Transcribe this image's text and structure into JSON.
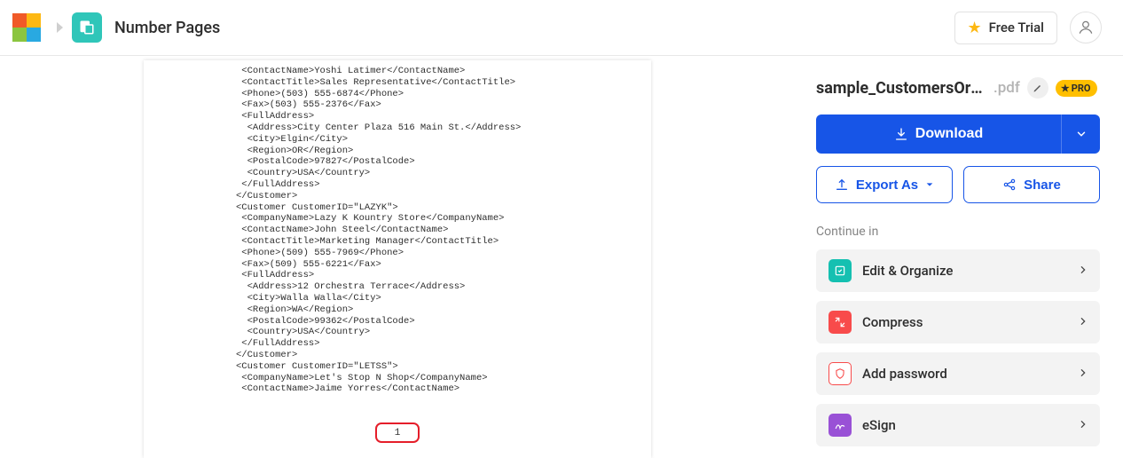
{
  "header": {
    "app_title": "Number Pages",
    "free_trial_label": "Free Trial"
  },
  "preview": {
    "page_number": "1",
    "xml": " <ContactName>Yoshi Latimer</ContactName>\n <ContactTitle>Sales Representative</ContactTitle>\n <Phone>(503) 555-6874</Phone>\n <Fax>(503) 555-2376</Fax>\n <FullAddress>\n  <Address>City Center Plaza 516 Main St.</Address>\n  <City>Elgin</City>\n  <Region>OR</Region>\n  <PostalCode>97827</PostalCode>\n  <Country>USA</Country>\n </FullAddress>\n</Customer>\n<Customer CustomerID=\"LAZYK\">\n <CompanyName>Lazy K Kountry Store</CompanyName>\n <ContactName>John Steel</ContactName>\n <ContactTitle>Marketing Manager</ContactTitle>\n <Phone>(509) 555-7969</Phone>\n <Fax>(509) 555-6221</Fax>\n <FullAddress>\n  <Address>12 Orchestra Terrace</Address>\n  <City>Walla Walla</City>\n  <Region>WA</Region>\n  <PostalCode>99362</PostalCode>\n  <Country>USA</Country>\n </FullAddress>\n</Customer>\n<Customer CustomerID=\"LETSS\">\n <CompanyName>Let's Stop N Shop</CompanyName>\n <ContactName>Jaime Yorres</ContactName>"
  },
  "sidebar": {
    "file_name": "sample_CustomersOrders-...",
    "file_ext": ".pdf",
    "pro_label": "PRO",
    "download_label": "Download",
    "export_label": "Export As",
    "share_label": "Share",
    "continue_label": "Continue in",
    "tools": [
      {
        "label": "Edit & Organize"
      },
      {
        "label": "Compress"
      },
      {
        "label": "Add password"
      },
      {
        "label": "eSign"
      }
    ]
  }
}
